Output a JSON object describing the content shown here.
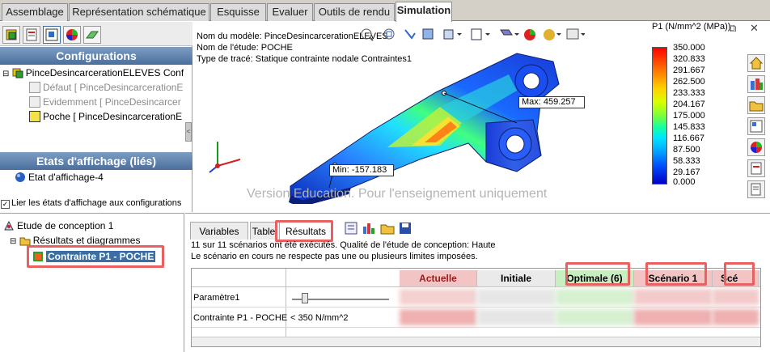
{
  "tabs": [
    "Assemblage",
    "Représentation schématique",
    "Esquisse",
    "Evaluer",
    "Outils de rendu",
    "Simulation"
  ],
  "active_tab": "Simulation",
  "left_panel": {
    "configurations_header": "Configurations",
    "tree": [
      "PinceDesincarcerationELEVES Confi",
      "Défaut [ PinceDesincarcerationE",
      "Evidemment [ PinceDesincarcer",
      "Poche [ PinceDesincarcerationE"
    ],
    "display_states_header": "Etats d'affichage (liés)",
    "display_state": "Etat d'affichage-4",
    "link_checkbox_label": "Lier les états d'affichage aux configurations",
    "link_checked": true
  },
  "graphics": {
    "model_name": "Nom du modèle: PinceDesincarcerationELEVES",
    "study_name": "Nom de l'étude: POCHE",
    "plot_type": "Type de tracé: Statique contrainte nodale Contraintes1",
    "max_label": "Max:",
    "max_value": "459.257",
    "min_label": "Min:",
    "min_value": "-157.183",
    "watermark": "Version Education. Pour l'enseignement uniquement",
    "legend_title": "P1 (N/mm^2 (MPa))",
    "legend_values": [
      "350.000",
      "320.833",
      "291.667",
      "262.500",
      "233.333",
      "204.167",
      "175.000",
      "145.833",
      "116.667",
      "87.500",
      "58.333",
      "29.167",
      "0.000"
    ]
  },
  "study_tree": {
    "root": "Etude de conception 1",
    "results_node": "Résultats et diagrammes",
    "selected": "Contrainte P1 - POCHE"
  },
  "study_panel": {
    "tabs": [
      "Variables",
      "Table",
      "Résultats"
    ],
    "active": "Résultats",
    "message1": "11 sur 11 scénarios ont été exécutés. Qualité de l'étude de conception: Haute",
    "message2": "Le scénario en cours ne respecte pas une ou plusieurs limites imposées.",
    "columns": [
      "Actuelle",
      "Initiale",
      "Optimale (6)",
      "Scénario 1",
      "Scé"
    ],
    "rows": [
      "Paramètre1",
      "Contrainte P1 - POCHE"
    ],
    "constraint": "< 350 N/mm^2"
  },
  "colors": {
    "actuelle_bg": "#f2c4c4",
    "optimale_bg": "#c8efc0",
    "highlight": "#e86060"
  }
}
